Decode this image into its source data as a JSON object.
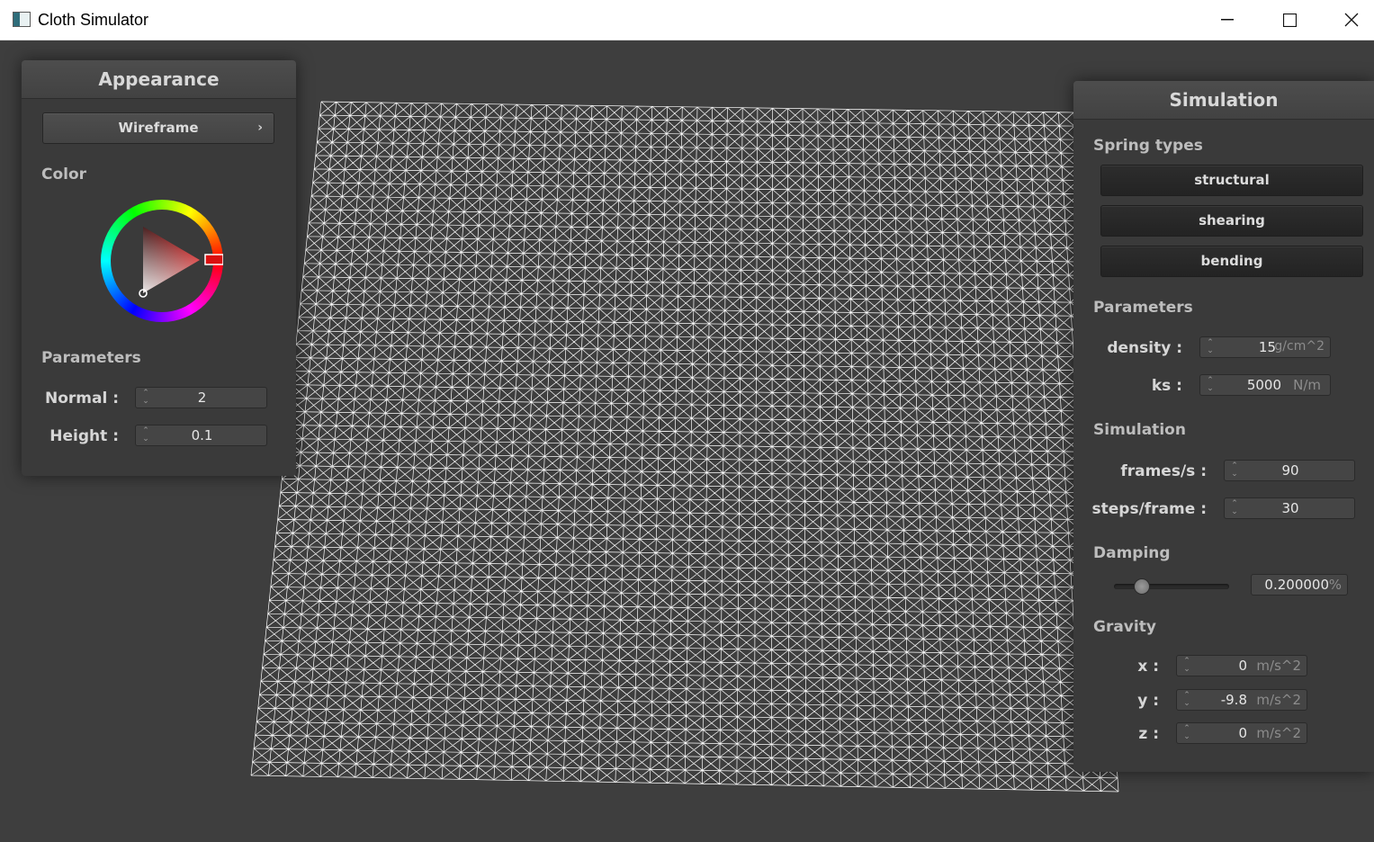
{
  "window": {
    "title": "Cloth Simulator",
    "minimize_glyph": "—",
    "maximize_glyph": "☐",
    "close_glyph": "✕"
  },
  "appearance": {
    "title": "Appearance",
    "shader_button": "Wireframe",
    "shader_chevron": "›",
    "color_label": "Color",
    "color_value": "#cc1111",
    "parameters_label": "Parameters",
    "normal": {
      "label": "Normal :",
      "value": "2"
    },
    "height": {
      "label": "Height :",
      "value": "0.1"
    }
  },
  "simulation": {
    "title": "Simulation",
    "spring_types_label": "Spring types",
    "springs": [
      "structural",
      "shearing",
      "bending"
    ],
    "parameters_label": "Parameters",
    "density": {
      "label": "density :",
      "value": "15",
      "unit": "g/cm^2"
    },
    "ks": {
      "label": "ks :",
      "value": "5000",
      "unit": "N/m"
    },
    "sim_label": "Simulation",
    "fps": {
      "label": "frames/s :",
      "value": "90"
    },
    "steps": {
      "label": "steps/frame :",
      "value": "30"
    },
    "damping_label": "Damping",
    "damping": {
      "value": "0.200000",
      "unit": "%",
      "slider_fraction": 0.2
    },
    "gravity_label": "Gravity",
    "gravity": [
      {
        "label": "x :",
        "value": "0",
        "unit": "m/s^2"
      },
      {
        "label": "y :",
        "value": "-9.8",
        "unit": "m/s^2"
      },
      {
        "label": "z :",
        "value": "0",
        "unit": "m/s^2"
      }
    ]
  },
  "spinner_glyph": "⌃⌄",
  "icons": {
    "app": "window-app-icon",
    "minimize": "minimize-icon",
    "maximize": "maximize-icon",
    "close": "close-icon"
  }
}
